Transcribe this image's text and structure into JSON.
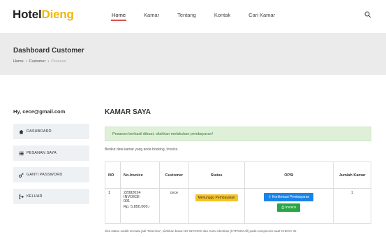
{
  "brand": {
    "part1": "Hotel",
    "part2": "Dieng"
  },
  "nav": {
    "items": [
      {
        "label": "Home"
      },
      {
        "label": "Kamar"
      },
      {
        "label": "Tentang"
      },
      {
        "label": "Kontak"
      },
      {
        "label": "Cari Kamar"
      }
    ]
  },
  "page_header": {
    "title": "Dashboard Customer",
    "breadcrumb": [
      "Home",
      "Customer",
      "Pesanan"
    ]
  },
  "sidebar": {
    "greeting": "Hy, cece@gmail.com",
    "items": [
      {
        "label": "DASHBOARD",
        "icon": "home-icon"
      },
      {
        "label": "PESANAN SAYA",
        "icon": "list-icon"
      },
      {
        "label": "GANTI PASSWORD",
        "icon": "key-icon"
      },
      {
        "label": "KELUAR",
        "icon": "logout-icon"
      }
    ]
  },
  "main": {
    "title": "KAMAR SAYA",
    "alert": "Pesanan berhasil dibuat, silahkan melakukan pembayaran!",
    "intro": "Berikut data kamar yang anda booking, Invoice.",
    "table": {
      "headers": [
        "NO",
        "No.Invoice",
        "Customer",
        "Status",
        "OPSI",
        "Jumlah Kamar"
      ],
      "rows": [
        {
          "no": "1",
          "invoice_date": "22082024",
          "invoice_code": "INVOICE-",
          "invoice_num": "001",
          "amount": "Rp. 5,850,000,-",
          "customer": "cece",
          "status": "Menunggu Pembayaran",
          "btn_confirm": "Konfirmasi Pembayaran",
          "btn_invoice": "Invoice",
          "jumlah": "1"
        }
      ]
    },
    "footnote": "Jika status sudah tercatat jadi \"Diterima\", silahkan bawa NO INVOICE dan Kartu Identitas (KTP/SIM dll) pada resepsionis saat CHECK IN."
  },
  "colors": {
    "brand_accent": "#f2b705",
    "nav_active_underline": "#d9534f",
    "alert_bg": "#dff0d8",
    "status_badge": "#f7c325",
    "btn_blue": "#1a84e6",
    "btn_green": "#28a745"
  }
}
